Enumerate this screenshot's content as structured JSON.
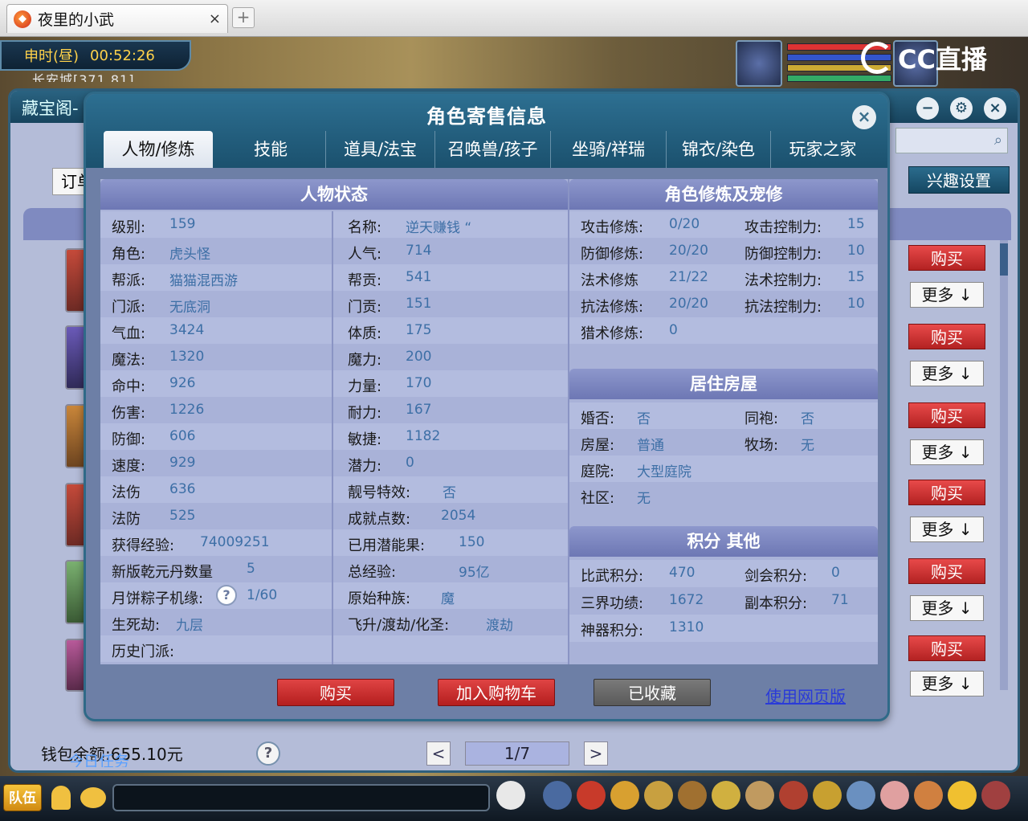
{
  "browser": {
    "tab_title": "夜里的小武",
    "new_tab": "+",
    "close": "×"
  },
  "game": {
    "time_period": "申时(昼)",
    "clock": "00:52:26",
    "location": "长安城[371,81]",
    "stream_logo": "CC直播"
  },
  "market": {
    "title": "藏宝阁-",
    "order": "订单",
    "interest_settings": "兴趣设置",
    "buy_label": "购买",
    "more_label": "更多",
    "wallet": "钱包余额:655.10元",
    "quest": "今日任务",
    "page": "1/7",
    "help": "?",
    "prev": "<",
    "next": ">",
    "team": "队伍"
  },
  "modal": {
    "title": "角色寄售信息",
    "tabs": [
      "人物/修炼",
      "技能",
      "道具/法宝",
      "召唤兽/孩子",
      "坐骑/祥瑞",
      "锦衣/染色",
      "玩家之家"
    ],
    "status_title": "人物状态",
    "status": [
      {
        "l1": "级别:",
        "v1": "159",
        "l2": "名称:",
        "v2": "逆天赚钱 “"
      },
      {
        "l1": "角色:",
        "v1": "虎头怪",
        "l2": "人气:",
        "v2": "714"
      },
      {
        "l1": "帮派:",
        "v1": "猫猫混西游",
        "l2": "帮贡:",
        "v2": "541"
      },
      {
        "l1": "门派:",
        "v1": "无底洞",
        "l2": "门贡:",
        "v2": "151"
      },
      {
        "l1": "气血:",
        "v1": "3424",
        "l2": "体质:",
        "v2": "175"
      },
      {
        "l1": "魔法:",
        "v1": "1320",
        "l2": "魔力:",
        "v2": "200"
      },
      {
        "l1": "命中:",
        "v1": "926",
        "l2": "力量:",
        "v2": "170"
      },
      {
        "l1": "伤害:",
        "v1": "1226",
        "l2": "耐力:",
        "v2": "167"
      },
      {
        "l1": "防御:",
        "v1": "606",
        "l2": "敏捷:",
        "v2": "1182"
      },
      {
        "l1": "速度:",
        "v1": "929",
        "l2": "潜力:",
        "v2": "0"
      },
      {
        "l1": "法伤",
        "v1": "636",
        "l2": "靓号特效:",
        "v2": "否"
      },
      {
        "l1": "法防",
        "v1": "525",
        "l2": "成就点数:",
        "v2": "2054"
      },
      {
        "l1": "获得经验:",
        "v1": "74009251",
        "l2": "已用潜能果:",
        "v2": "150"
      },
      {
        "l1": "新版乾元丹数量",
        "v1": "5",
        "l2": "总经验:",
        "v2": "95亿"
      },
      {
        "l1": "月饼粽子机缘:",
        "v1": "1/60",
        "l2": "原始种族:",
        "v2": "魔"
      },
      {
        "l1": "生死劫:",
        "v1": "九层",
        "l2": "飞升/渡劫/化圣:",
        "v2": "渡劫"
      },
      {
        "l1": "历史门派:",
        "v1": "",
        "l2": "",
        "v2": ""
      }
    ],
    "cultivation_title": "角色修炼及宠修",
    "cultivation": [
      {
        "l1": "攻击修炼:",
        "v1": "0/20",
        "l2": "攻击控制力:",
        "v2": "15"
      },
      {
        "l1": "防御修炼:",
        "v1": "20/20",
        "l2": "防御控制力:",
        "v2": "10"
      },
      {
        "l1": "法术修炼",
        "v1": "21/22",
        "l2": "法术控制力:",
        "v2": "15"
      },
      {
        "l1": "抗法修炼:",
        "v1": "20/20",
        "l2": "抗法控制力:",
        "v2": "10"
      },
      {
        "l1": "猎术修炼:",
        "v1": "0",
        "l2": "",
        "v2": ""
      }
    ],
    "house_title": "居住房屋",
    "house": [
      {
        "l1": "婚否:",
        "v1": "否",
        "l2": "同袍:",
        "v2": "否"
      },
      {
        "l1": "房屋:",
        "v1": "普通",
        "l2": "牧场:",
        "v2": "无"
      },
      {
        "l1": "庭院:",
        "v1": "大型庭院",
        "l2": "",
        "v2": ""
      },
      {
        "l1": "社区:",
        "v1": "无",
        "l2": "",
        "v2": ""
      }
    ],
    "score_title": "积分 其他",
    "score": [
      {
        "l1": "比武积分:",
        "v1": "470",
        "l2": "剑会积分:",
        "v2": "0"
      },
      {
        "l1": "三界功绩:",
        "v1": "1672",
        "l2": "副本积分:",
        "v2": "71"
      },
      {
        "l1": "神器积分:",
        "v1": "1310",
        "l2": "",
        "v2": ""
      }
    ],
    "buttons": {
      "buy": "购买",
      "cart": "加入购物车",
      "favorited": "已收藏",
      "web": "使用网页版"
    },
    "close": "×"
  },
  "colors": {
    "accent": "#2d6f91",
    "buy_red": "#c42828",
    "value_blue": "#3d6fa6"
  }
}
